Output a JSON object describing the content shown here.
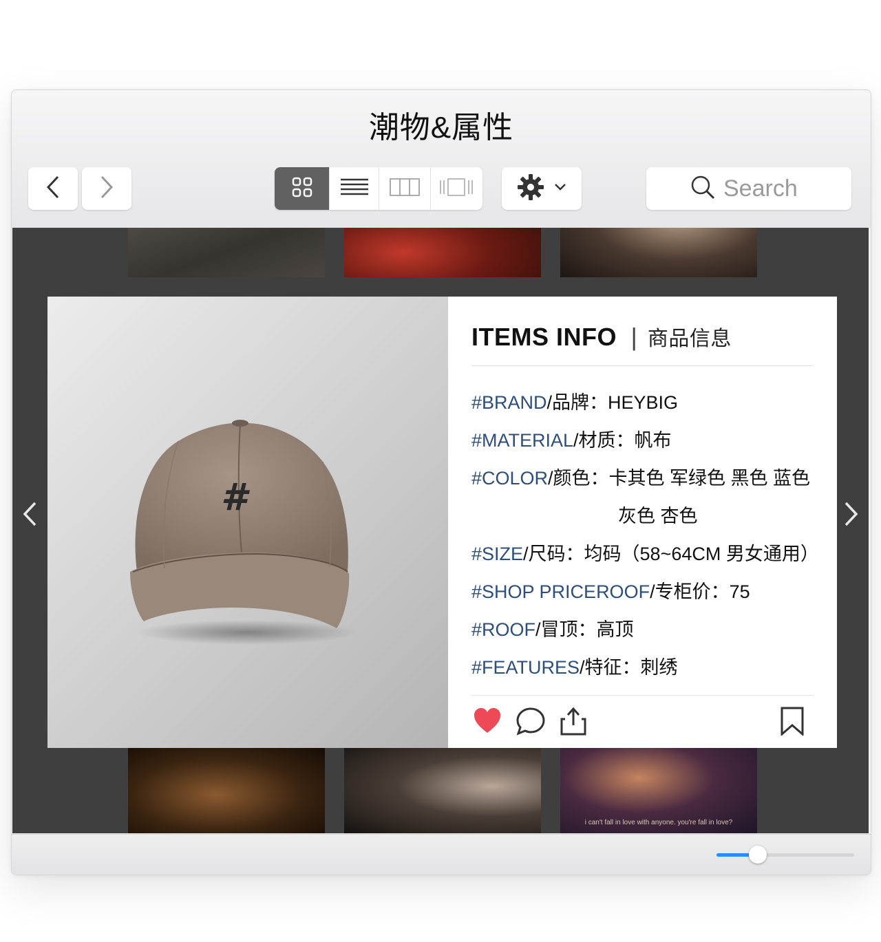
{
  "window": {
    "title": "潮物&属性"
  },
  "toolbar": {
    "back_icon": "chevron-left-icon",
    "forward_icon": "chevron-right-icon",
    "view_modes": [
      "grid-view-icon",
      "list-view-icon",
      "column-view-icon",
      "cover-flow-icon"
    ],
    "active_view": "grid",
    "settings_icon": "gear-icon",
    "search": {
      "placeholder": "Search",
      "value": ""
    }
  },
  "gallery": {
    "top_thumbs": [
      "dark wood texture",
      "red scene",
      "dark sepia scene"
    ],
    "bottom_thumbs": [
      "couple close-up",
      "man profile scene",
      "woman scene"
    ],
    "bottom_caption": "i can't fall in love with anyone. you're fall in love?"
  },
  "card": {
    "title": "ITEMS INFO",
    "subtitle": "商品信息",
    "attributes": [
      {
        "key": "#BRAND",
        "text": "/品牌：HEYBIG"
      },
      {
        "key": "#MATERIAL",
        "text": "/材质：帆布"
      },
      {
        "key": "#COLOR",
        "text": "/颜色：卡其色 军绿色 黑色 蓝色"
      },
      {
        "key": "",
        "text": "灰色 杏色"
      },
      {
        "key": "#SIZE",
        "text": "/尺码：均码（58~64CM 男女通用）"
      },
      {
        "key": "#SHOP PRICEROOF",
        "text": "/专柜价：75"
      },
      {
        "key": "#ROOF",
        "text": "/冒顶：高顶"
      },
      {
        "key": "#FEATURES",
        "text": "/特征：刺绣"
      }
    ],
    "actions": [
      "heart-icon",
      "comment-icon",
      "share-icon",
      "bookmark-icon"
    ],
    "liked": true,
    "like_color": "#ed4956"
  },
  "zoom": {
    "level": 0.3
  },
  "colors": {
    "accent": "#2a8cff",
    "attr_key": "#2e4e7a",
    "content_bg": "#3f3f3f"
  }
}
